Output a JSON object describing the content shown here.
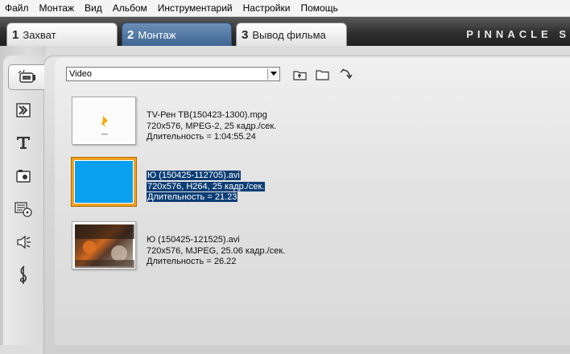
{
  "menu": [
    "Файл",
    "Монтаж",
    "Вид",
    "Альбом",
    "Инструментарий",
    "Настройки",
    "Помощь"
  ],
  "tabs": [
    {
      "num": "1",
      "label": "Захват",
      "active": false
    },
    {
      "num": "2",
      "label": "Монтаж",
      "active": true
    },
    {
      "num": "3",
      "label": "Вывод фильма",
      "active": false
    }
  ],
  "brand": "PINNACLE S",
  "tools": [
    "video-clips-icon",
    "transitions-icon",
    "titles-icon",
    "photos-icon",
    "disc-menus-icon",
    "sound-effects-icon",
    "music-icon"
  ],
  "album": {
    "source_select": "Video"
  },
  "clips": [
    {
      "name": "TV-Рен ТВ(150423-1300).mpg",
      "format": "720x576, MPEG-2, 25 кадр./сек.",
      "duration": "Длительность = 1:04:55.24",
      "selected": false
    },
    {
      "name": "Ю (150425-112705).avi",
      "format": "720x576, H264, 25 кадр./сек.",
      "duration": "Длительность = 21.23",
      "selected": true
    },
    {
      "name": "Ю (150425-121525).avi",
      "format": "720x576, MJPEG, 25.06 кадр./сек.",
      "duration": "Длительность = 26.22",
      "selected": false
    }
  ],
  "colors": {
    "selection": "#0c3d75",
    "active_tab": "#4f74a0",
    "selected_thumb_border": "#f0a020",
    "blue_clip": "#0aa0f0"
  }
}
